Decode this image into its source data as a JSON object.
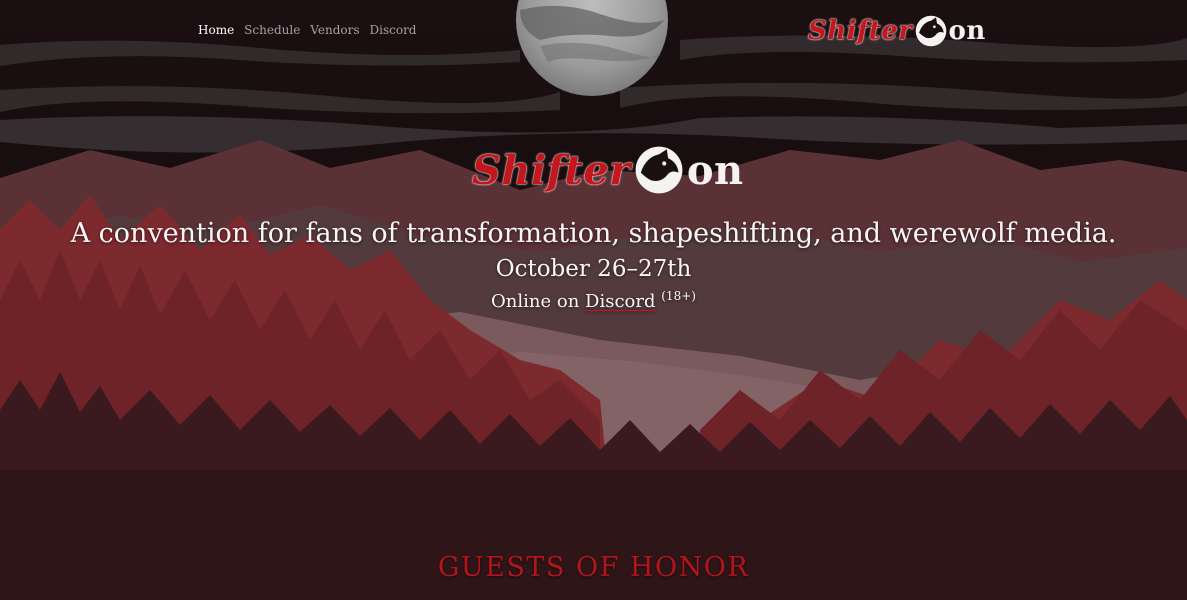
{
  "nav": {
    "items": [
      {
        "label": "Home",
        "active": true
      },
      {
        "label": "Schedule",
        "active": false
      },
      {
        "label": "Vendors",
        "active": false
      },
      {
        "label": "Discord",
        "active": false
      }
    ]
  },
  "logo": {
    "part_shifter": "Shifter",
    "part_on": "on",
    "mark_icon": "wolf-head-icon"
  },
  "hero": {
    "tagline": "A convention for fans of transformation, shapeshifting, and werewolf media.",
    "dates": "October 26–27th",
    "online_prefix": "Online on ",
    "online_link": "Discord",
    "age_note": "(18+)"
  },
  "guests_heading": "GUESTS OF HONOR",
  "colors": {
    "accent_red": "#c4161c",
    "sky": "#150b0d",
    "forest_dark": "#2e1518"
  }
}
